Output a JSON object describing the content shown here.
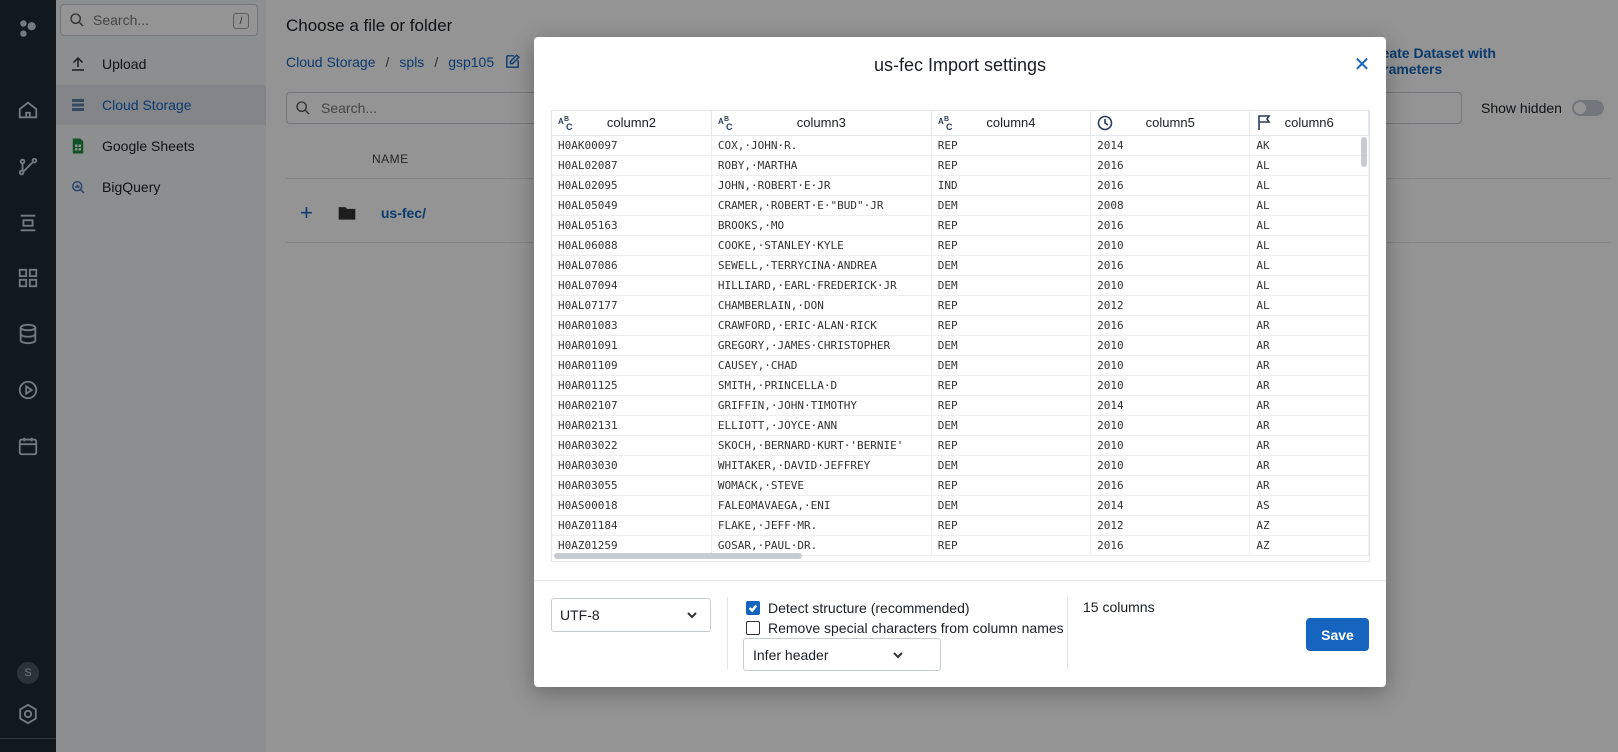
{
  "sidebar": {
    "search_placeholder": "Search...",
    "search_shortcut": "/",
    "items": [
      {
        "label": "Upload",
        "icon": "upload-icon"
      },
      {
        "label": "Cloud Storage",
        "icon": "database-icon",
        "active": true
      },
      {
        "label": "Google Sheets",
        "icon": "sheets-icon"
      },
      {
        "label": "BigQuery",
        "icon": "bigquery-icon"
      }
    ],
    "avatar_initial": "S"
  },
  "main": {
    "title": "Choose a file or folder",
    "breadcrumbs": [
      "Cloud Storage",
      "spls",
      "gsp105"
    ],
    "create_button": "Create Dataset with Parameters",
    "search_placeholder": "Search...",
    "show_hidden_label": "Show hidden",
    "name_header": "NAME",
    "folder_name": "us-fec/"
  },
  "modal": {
    "title": "us-fec Import settings",
    "columns": [
      {
        "name": "column2",
        "type_icon": "string-type-icon"
      },
      {
        "name": "column3",
        "type_icon": "string-type-icon"
      },
      {
        "name": "column4",
        "type_icon": "string-type-icon"
      },
      {
        "name": "column5",
        "type_icon": "datetime-type-icon"
      },
      {
        "name": "column6",
        "type_icon": "state-flag-icon"
      }
    ],
    "rows": [
      [
        "H0AK00097",
        "COX,·JOHN·R.",
        "REP",
        "2014",
        "AK"
      ],
      [
        "H0AL02087",
        "ROBY,·MARTHA",
        "REP",
        "2016",
        "AL"
      ],
      [
        "H0AL02095",
        "JOHN,·ROBERT·E·JR",
        "IND",
        "2016",
        "AL"
      ],
      [
        "H0AL05049",
        "CRAMER,·ROBERT·E·\"BUD\"·JR",
        "DEM",
        "2008",
        "AL"
      ],
      [
        "H0AL05163",
        "BROOKS,·MO",
        "REP",
        "2016",
        "AL"
      ],
      [
        "H0AL06088",
        "COOKE,·STANLEY·KYLE",
        "REP",
        "2010",
        "AL"
      ],
      [
        "H0AL07086",
        "SEWELL,·TERRYCINA·ANDREA",
        "DEM",
        "2016",
        "AL"
      ],
      [
        "H0AL07094",
        "HILLIARD,·EARL·FREDERICK·JR",
        "DEM",
        "2010",
        "AL"
      ],
      [
        "H0AL07177",
        "CHAMBERLAIN,·DON",
        "REP",
        "2012",
        "AL"
      ],
      [
        "H0AR01083",
        "CRAWFORD,·ERIC·ALAN·RICK",
        "REP",
        "2016",
        "AR"
      ],
      [
        "H0AR01091",
        "GREGORY,·JAMES·CHRISTOPHER",
        "DEM",
        "2010",
        "AR"
      ],
      [
        "H0AR01109",
        "CAUSEY,·CHAD",
        "DEM",
        "2010",
        "AR"
      ],
      [
        "H0AR01125",
        "SMITH,·PRINCELLA·D",
        "REP",
        "2010",
        "AR"
      ],
      [
        "H0AR02107",
        "GRIFFIN,·JOHN·TIMOTHY",
        "REP",
        "2014",
        "AR"
      ],
      [
        "H0AR02131",
        "ELLIOTT,·JOYCE·ANN",
        "DEM",
        "2010",
        "AR"
      ],
      [
        "H0AR03022",
        "SKOCH,·BERNARD·KURT·'BERNIE'",
        "REP",
        "2010",
        "AR"
      ],
      [
        "H0AR03030",
        "WHITAKER,·DAVID·JEFFREY",
        "DEM",
        "2010",
        "AR"
      ],
      [
        "H0AR03055",
        "WOMACK,·STEVE",
        "REP",
        "2016",
        "AR"
      ],
      [
        "H0AS00018",
        "FALEOMAVAEGA,·ENI",
        "DEM",
        "2014",
        "AS"
      ],
      [
        "H0AZ01184",
        "FLAKE,·JEFF·MR.",
        "REP",
        "2012",
        "AZ"
      ],
      [
        "H0AZ01259",
        "GOSAR,·PAUL·DR.",
        "REP",
        "2016",
        "AZ"
      ]
    ],
    "encoding": "UTF-8",
    "detect_structure_label": "Detect structure (recommended)",
    "detect_structure_checked": true,
    "remove_special_label": "Remove special characters from column names",
    "remove_special_checked": false,
    "header_option": "Infer header",
    "column_count": "15 columns",
    "save_label": "Save"
  },
  "colors": {
    "accent": "#1565c0",
    "rail": "#1d2b36"
  }
}
